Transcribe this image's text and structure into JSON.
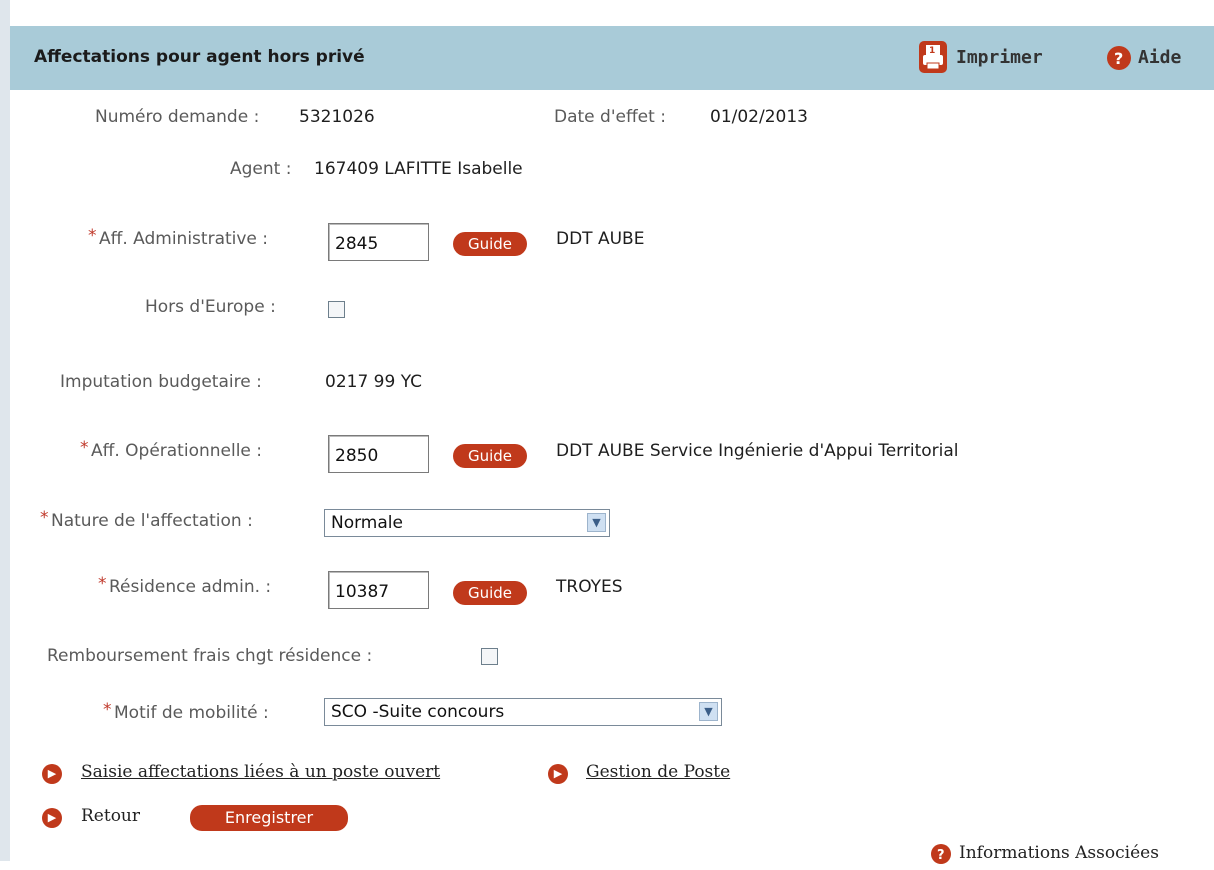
{
  "header": {
    "title": "Affectations pour agent hors privé",
    "print_label": "Imprimer",
    "help_label": "Aide"
  },
  "info": {
    "numero_label": "Numéro demande :",
    "numero_value": "5321026",
    "date_label": "Date d'effet :",
    "date_value": "01/02/2013",
    "agent_label": "Agent :",
    "agent_value": "167409 LAFITTE Isabelle"
  },
  "form": {
    "required_mark": "*",
    "aff_admin_label": "Aff. Administrative :",
    "aff_admin_value": "2845",
    "aff_admin_text": "DDT AUBE",
    "hors_europe_label": "Hors d'Europe :",
    "imputation_label": "Imputation budgetaire :",
    "imputation_value": "0217 99 YC",
    "aff_oper_label": "Aff. Opérationnelle :",
    "aff_oper_value": "2850",
    "aff_oper_text": "DDT AUBE Service Ingénierie d'Appui Territorial",
    "nature_label": "Nature de l'affectation :",
    "nature_value": "Normale",
    "residence_label": "Résidence admin. :",
    "residence_value": "10387",
    "residence_text": "TROYES",
    "remboursement_label": "Remboursement frais chgt résidence :",
    "motif_label": "Motif de mobilité :",
    "motif_value": "SCO -Suite concours",
    "guide_label": "Guide"
  },
  "links": {
    "saisie": "Saisie affectations liées à un poste ouvert",
    "gestion": "Gestion de Poste",
    "retour": "Retour",
    "enregistrer": "Enregistrer",
    "infos": "Informations Associées"
  },
  "icons": {
    "print": "print-icon",
    "help": "help-icon",
    "arrow": "arrow-right-icon",
    "dropdown": "chevron-down-icon"
  },
  "colors": {
    "header_bg": "#a9cbd8",
    "accent": "#c0391b"
  }
}
